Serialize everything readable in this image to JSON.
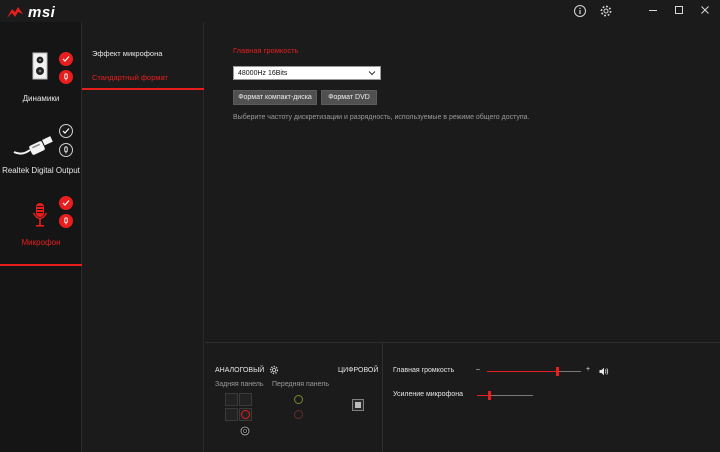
{
  "app": {
    "logo_text": "msi"
  },
  "titlebar": {
    "info_icon": "info-icon",
    "settings_icon": "gear-icon",
    "minimize": "—",
    "maximize": "☐",
    "close": "✕"
  },
  "devices": [
    {
      "label": "Динамики",
      "icon": "speaker-icon",
      "status": "enabled",
      "active": false
    },
    {
      "label": "Realtek Digital Output",
      "icon": "digital-output-icon",
      "status": "default",
      "active": false
    },
    {
      "label": "Микрофон",
      "icon": "microphone-icon",
      "status": "enabled",
      "active": true
    }
  ],
  "tabs": [
    {
      "label": "Эффект микрофона",
      "active": false
    },
    {
      "label": "Стандартный формат",
      "active": true
    }
  ],
  "main": {
    "section_title": "Главная громкость",
    "format_select": {
      "value": "48000Hz 16Bits"
    },
    "buttons": {
      "cd_format": "Формат компакт-диска",
      "dvd_format": "Формат DVD"
    },
    "hint": "Выберите частоту дискретизации и разрядность, используемые в режиме общего доступа."
  },
  "bottom": {
    "analog_label": "АНАЛОГОВЫЙ",
    "digital_label": "ЦИФРОВОЙ",
    "rear_panel": "Задняя панель",
    "front_panel": "Передняя панель",
    "master_volume_label": "Главная громкость",
    "master_volume": 0.74,
    "minus": "–",
    "plus": "+",
    "mic_boost_label": "Усиление микрофона",
    "mic_boost": 0.22
  },
  "colors": {
    "accent": "#e81e1e",
    "background": "#1b1b1b",
    "panel": "#151515"
  }
}
